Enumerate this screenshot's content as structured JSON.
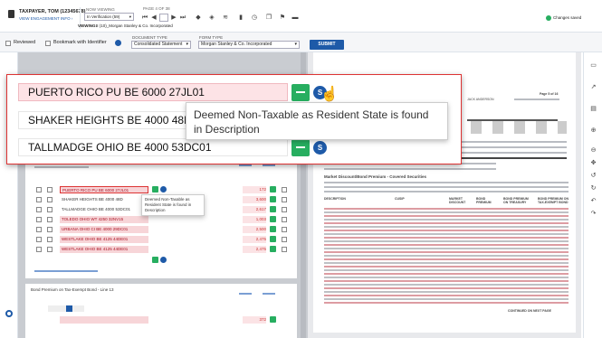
{
  "header": {
    "taxpayer": "TAXPAYER, TOM (12345678)",
    "view_engagement": "VIEW ENGAGEMENT INFO ›",
    "now_viewing_label": "NOW VIEWING",
    "status_select": "In Verification (59)",
    "page_of": "PAGE 4 OF 38",
    "viewing_label": "VIEWING:",
    "viewing_value": "8 (10)_Morgan Stanley & Co. Incorporated",
    "changes_saved": "Changes saved"
  },
  "toolbar2": {
    "reviewed": "Reviewed",
    "bookmark": "Bookmark with Identifier",
    "doctype_label": "DOCUMENT TYPE",
    "doctype_value": "Consolidated Statement",
    "formtype_label": "FORM TYPE",
    "formtype_value": "Morgan Stanley & Co. Incorporated",
    "submit": "SUBMIT"
  },
  "zoom": {
    "rows": [
      {
        "name": "PUERTO RICO PU BE 6000 27JL01"
      },
      {
        "name": "SHAKER HEIGHTS BE 4000 48D"
      },
      {
        "name": "TALLMADGE OHIO BE 4000 53DC01"
      }
    ],
    "s_label": "S",
    "tooltip": "Deemed Non-Taxable as Resident State is found in Description"
  },
  "list": {
    "rows": [
      {
        "name": "PUERTO RICO PU BE 6000 27JL01",
        "amount": "172",
        "pink": true
      },
      {
        "name": "SHAKER HEIGHTS BE 4000 48D",
        "amount": "3,600",
        "pink": false
      },
      {
        "name": "TALLMADGE OHIO BE 4000 53DC01",
        "amount": "2,617",
        "pink": false
      },
      {
        "name": "TOLEDO OHIO WT 4250 32NV15",
        "amount": "1,003",
        "pink": true
      },
      {
        "name": "URBANA OHIO CI BE 4000 29DC01",
        "amount": "2,500",
        "pink": true
      },
      {
        "name": "WESTLAKE OHIO BE 4125 44DE01",
        "amount": "2,475",
        "pink": true
      },
      {
        "name": "WESTLAKE OHIO BE 4125 44DE01",
        "amount": "2,475",
        "pink": true
      }
    ],
    "tooltip": "Deemed Non-Taxable as Resident State is found in Description",
    "section2": "Bond Premium on Tax-Exempt Bond - Line 13",
    "footer_amount": "372"
  },
  "doc": {
    "page": "Page 5 of 16",
    "name": "JACK ANDERSON",
    "section": "Market Discount/Bond Premium - Covered Securities",
    "continued": "CONTINUED ON NEXT PAGE",
    "columns": [
      "DESCRIPTION",
      "CUSIP",
      "MARKET DISCOUNT",
      "BOND PREMIUM",
      "BOND PREMIUM ON TREASURY",
      "BOND PREMIUM ON TAX-EXEMPT BOND"
    ]
  },
  "colors": {
    "accent": "#1e5aa8",
    "green": "#27ae60",
    "pink": "#fde3e6",
    "red": "#d33"
  }
}
